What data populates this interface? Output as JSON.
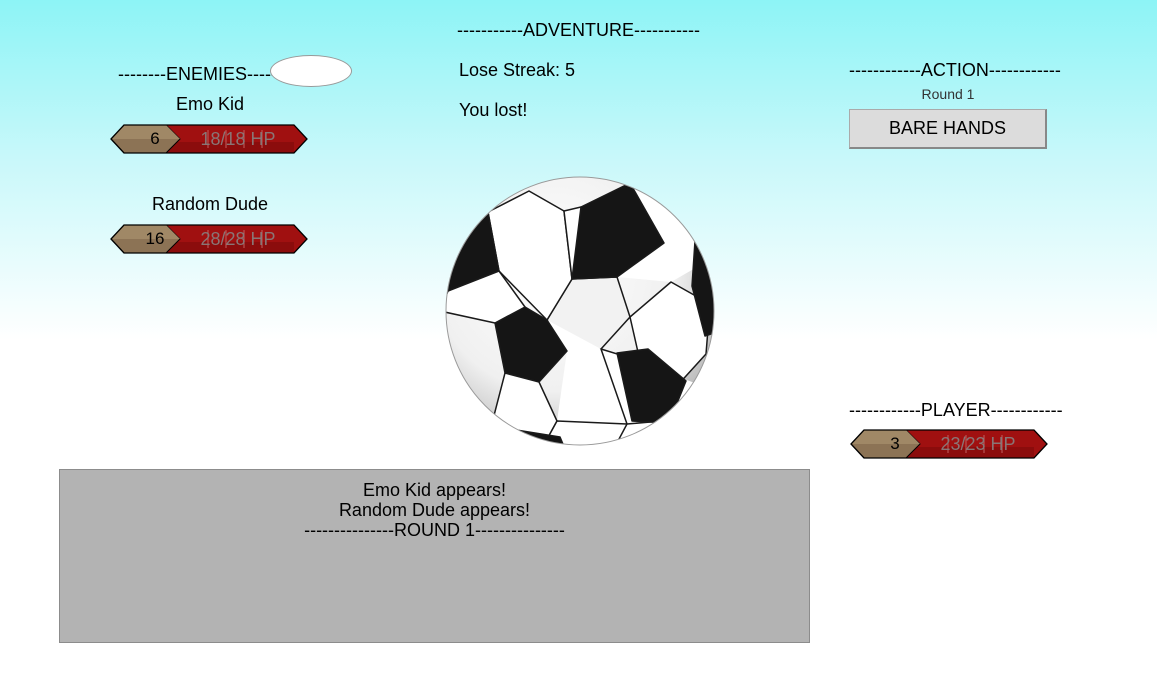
{
  "header": {
    "title": "-----------ADVENTURE-----------"
  },
  "enemies": {
    "header": "--------ENEMIES--------",
    "list": [
      {
        "name": "Emo Kid",
        "level": "6",
        "hp_text": "18/18 HP",
        "hp_fraction": 1.0
      },
      {
        "name": "Random Dude",
        "level": "16",
        "hp_text": "28/28 HP",
        "hp_fraction": 1.0
      }
    ]
  },
  "status": {
    "streak": "Lose Streak: 5",
    "result": "You lost!"
  },
  "action": {
    "header": "------------ACTION------------",
    "round": "Round 1",
    "weapon_button": "BARE HANDS"
  },
  "player": {
    "header": "------------PLAYER------------",
    "level": "3",
    "hp_text": "23/23 HP",
    "hp_fraction": 1.0
  },
  "log": {
    "lines": [
      "Emo Kid appears!",
      "Random Dude appears!",
      "---------------ROUND 1---------------"
    ]
  },
  "icons": {
    "center_image": "soccer-ball-icon"
  },
  "colors": {
    "hp_red": "#a01010",
    "level_brown": "#8c7355",
    "log_bg": "#b3b3b3"
  }
}
